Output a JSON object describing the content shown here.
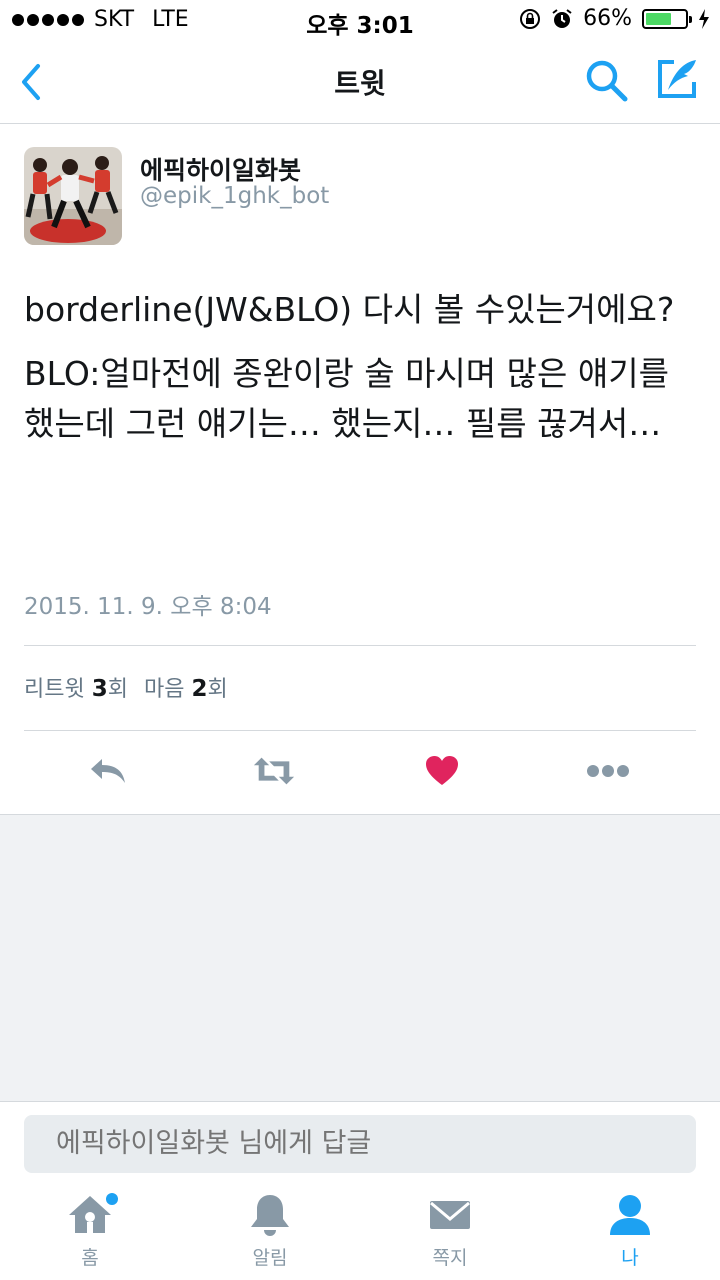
{
  "status_bar": {
    "carrier": "SKT",
    "network": "LTE",
    "time": "오후 3:01",
    "battery_percent": "66%",
    "battery_level": 0.66
  },
  "nav": {
    "title": "트윗",
    "back_icon": "chevron-left-icon",
    "search_icon": "search-icon",
    "compose_icon": "compose-icon"
  },
  "tweet": {
    "display_name": "에픽하이일화봇",
    "handle": "@epik_1ghk_bot",
    "paragraphs": [
      "borderline(JW&BLO) 다시 볼 수있는거에요?",
      "BLO:얼마전에 종완이랑 술 마시며 많은 얘기를 했는데 그런 얘기는… 했는지… 필름 끊겨서…"
    ],
    "timestamp": "2015. 11. 9. 오후 8:04",
    "stats": {
      "retweet_label": "리트윗",
      "retweet_count": "3",
      "retweet_unit": "회",
      "like_label": "마음",
      "like_count": "2",
      "like_unit": "회"
    }
  },
  "reply": {
    "placeholder": "에픽하이일화봇 님에게 답글"
  },
  "tabs": [
    {
      "label": "홈",
      "icon": "home-icon",
      "active": false,
      "badge": true
    },
    {
      "label": "알림",
      "icon": "bell-icon",
      "active": false,
      "badge": false
    },
    {
      "label": "쪽지",
      "icon": "envelope-icon",
      "active": false,
      "badge": false
    },
    {
      "label": "나",
      "icon": "person-icon",
      "active": true,
      "badge": false
    }
  ],
  "colors": {
    "accent": "#1da1f2",
    "like": "#e0245e",
    "muted": "#8899a6"
  }
}
